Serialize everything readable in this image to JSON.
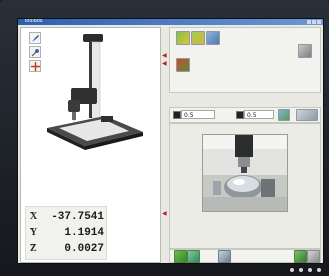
{
  "window": {
    "title": "Toolbox"
  },
  "left_tools": [
    {
      "icon": "pin-icon"
    },
    {
      "icon": "probe-icon"
    },
    {
      "icon": "crosshair-icon"
    }
  ],
  "coordinates": [
    {
      "axis": "X",
      "value": "-37.7541"
    },
    {
      "axis": "Y",
      "value": "1.1914"
    },
    {
      "axis": "Z",
      "value": "0.0027"
    }
  ],
  "right": {
    "toolbar_icons": [
      "tool-green-icon",
      "tool-yellow-icon",
      "tool-blue-icon"
    ],
    "field_a": "0.5",
    "field_b": "0.5"
  },
  "colors": {
    "accent": "#2d5fb0",
    "background": "#e9e9e4",
    "marker": "#c21c1c"
  }
}
